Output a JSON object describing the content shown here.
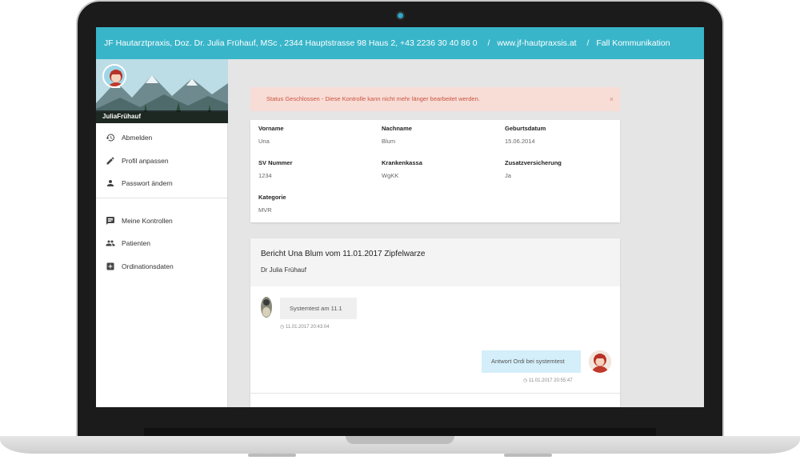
{
  "header": {
    "practice": "JF Hautarztpraxis, Doz. Dr. Julia Frühauf, MSc , 2344 Hauptstrasse 98 Haus 2, +43 2236 30 40 86 0",
    "separator": "/",
    "website": "www.jf-hautpraxsis.at",
    "section": "Fall Kommunikation"
  },
  "sidebar": {
    "profile_name": "JuliaFrühauf",
    "items_top": [
      {
        "label": "Abmelden",
        "icon": "history-icon"
      },
      {
        "label": "Profil anpassen",
        "icon": "pencil-icon"
      },
      {
        "label": "Passwort ändern",
        "icon": "person-icon"
      }
    ],
    "items_bottom": [
      {
        "label": "Meine Kontrollen",
        "icon": "message-icon"
      },
      {
        "label": "Patienten",
        "icon": "people-icon"
      },
      {
        "label": "Ordinationsdaten",
        "icon": "plus-box-icon"
      }
    ]
  },
  "alert": {
    "text": "Status Geschlossen - Diese Kontrolle kann nicht mehr länger bearbeitet werden.",
    "close": "×"
  },
  "patient": {
    "vorname_label": "Vorname",
    "vorname": "Una",
    "nachname_label": "Nachname",
    "nachname": "Blum",
    "geburtsdatum_label": "Geburtsdatum",
    "geburtsdatum": "15.06.2014",
    "sv_label": "SV Nummer",
    "sv": "1234",
    "kasse_label": "Krankenkassa",
    "kasse": "WgKK",
    "zusatz_label": "Zusatzversicherung",
    "zusatz": "Ja",
    "kategorie_label": "Kategorie",
    "kategorie": "MVR"
  },
  "report": {
    "title": "Bericht Una Blum vom 11.01.2017 Zipfelwarze",
    "author": "Dr Julia Frühauf",
    "messages": [
      {
        "text": "Systemtest am 11.1",
        "time": "11.01.2017 20:43:04",
        "side": "left"
      },
      {
        "text": "Antwort Ordi bei systemtest",
        "time": "11.01.2017 20:55:47",
        "side": "right"
      }
    ]
  },
  "colors": {
    "header": "#39b5c9",
    "alert_bg": "#f8dcd6",
    "alert_text": "#c9543f",
    "reply_bubble": "#d4eefa"
  }
}
